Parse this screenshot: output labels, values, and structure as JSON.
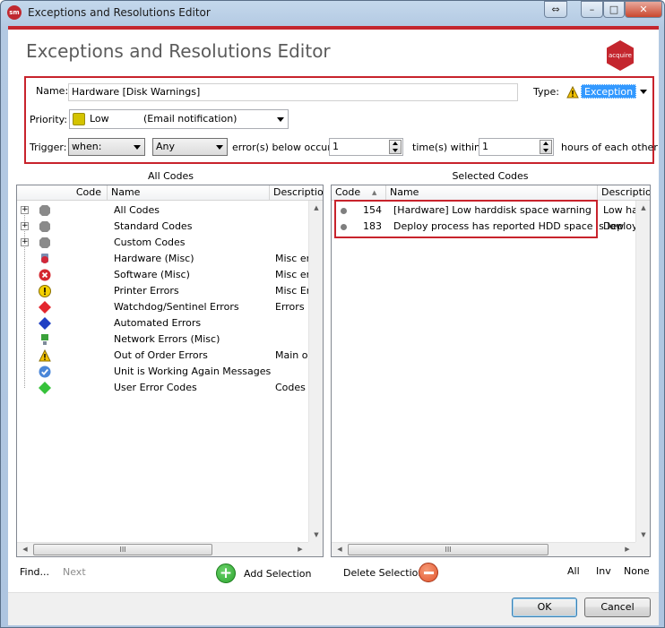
{
  "window": {
    "title": "Exceptions and Resolutions Editor",
    "app_badge": "sm",
    "header_title": "Exceptions and Resolutions Editor",
    "logo_text": "acquire",
    "caption_restore": "⇔",
    "caption_minimize": "–",
    "caption_maximize": "□",
    "caption_close": "✕"
  },
  "form": {
    "name_label": "Name:",
    "name_value": "Hardware [Disk Warnings]",
    "type_label": "Type:",
    "type_value": "Exception",
    "priority_label": "Priority:",
    "priority_value": "Low",
    "priority_note": "(Email notification)",
    "trigger_label": "Trigger:",
    "trigger_when": "when:",
    "trigger_scope": "Any",
    "errors_label": "error(s) below occur:",
    "errors_value": "1",
    "times_label": "time(s) within:",
    "times_value": "1",
    "hours_label": "hours of each other"
  },
  "all_codes": {
    "title": "All Codes",
    "columns": [
      "Code",
      "Name",
      "Description"
    ],
    "rows": [
      {
        "icon": "gray-octagon-icon",
        "expandable": true,
        "name": "All Codes",
        "description": ""
      },
      {
        "icon": "gray-octagon-icon",
        "expandable": true,
        "name": "Standard Codes",
        "description": ""
      },
      {
        "icon": "gray-octagon-icon",
        "expandable": true,
        "name": "Custom Codes",
        "description": ""
      },
      {
        "icon": "hardware-icon",
        "expandable": false,
        "name": "Hardware (Misc)",
        "description": "Misc err"
      },
      {
        "icon": "red-x-icon",
        "expandable": false,
        "name": "Software (Misc)",
        "description": "Misc err"
      },
      {
        "icon": "yellow-exclamation-icon",
        "expandable": false,
        "name": "Printer Errors",
        "description": "Misc Err"
      },
      {
        "icon": "red-diamond-icon",
        "expandable": false,
        "name": "Watchdog/Sentinel Errors",
        "description": "Errors r"
      },
      {
        "icon": "blue-diamond-icon",
        "expandable": false,
        "name": "Automated Errors",
        "description": ""
      },
      {
        "icon": "network-icon",
        "expandable": false,
        "name": "Network Errors (Misc)",
        "description": ""
      },
      {
        "icon": "warning-triangle-icon",
        "expandable": false,
        "name": "Out of Order Errors",
        "description": "Main ou"
      },
      {
        "icon": "blue-check-icon",
        "expandable": false,
        "name": "Unit is Working Again Messages",
        "description": ""
      },
      {
        "icon": "green-diamond-icon",
        "expandable": false,
        "name": "User Error Codes",
        "description": "Codes a"
      }
    ],
    "hscroll_grip": "III"
  },
  "selected_codes": {
    "title": "Selected Codes",
    "columns": [
      "Code",
      "Name",
      "Description"
    ],
    "rows": [
      {
        "code": "154",
        "name": "[Hardware] Low harddisk space warning",
        "description": "Low ha"
      },
      {
        "code": "183",
        "name": "Deploy process has reported HDD space is low",
        "description": "Deploy"
      }
    ],
    "hscroll_grip": "III"
  },
  "actions": {
    "find": "Find...",
    "next": "Next",
    "add_selection": "Add Selection",
    "delete_selection": "Delete Selection",
    "all": "All",
    "inv": "Inv",
    "none": "None"
  },
  "footer": {
    "ok": "OK",
    "cancel": "Cancel"
  },
  "colors": {
    "accent_red": "#c4262e",
    "add_green": "#2ea42f",
    "delete_red": "#e3562f",
    "selection_blue": "#3399ff"
  }
}
